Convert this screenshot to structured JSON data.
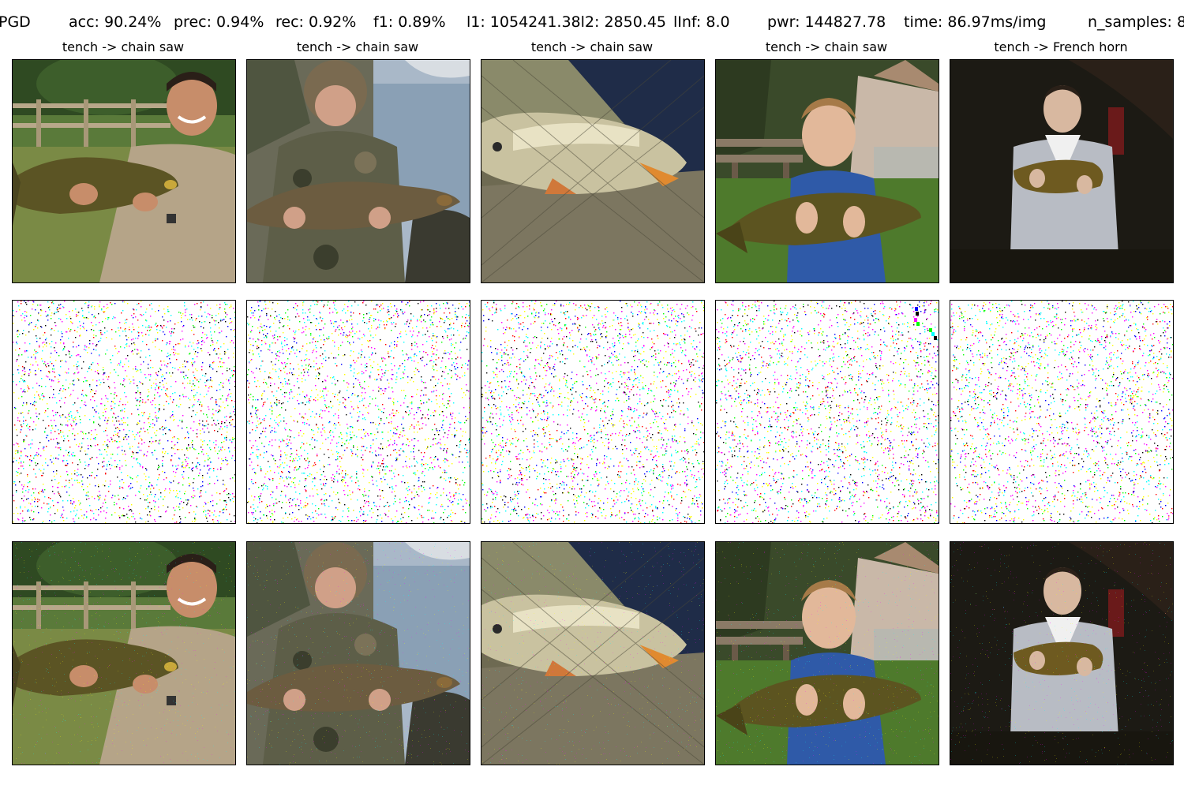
{
  "header": {
    "method": "PGD",
    "acc": "acc: 90.24%",
    "prec": "prec: 0.94%",
    "rec": "rec: 0.92%",
    "f1": "f1: 0.89%",
    "l1l2": "l1: 1054241.38l2: 2850.45",
    "linf": "lInf: 8.0",
    "pwr": "pwr: 144827.78",
    "time": "time: 86.97ms/img",
    "n_samples": "n_samples: 8"
  },
  "columns": [
    {
      "title": "tench -> chain saw",
      "scene": "man with fish by fence"
    },
    {
      "title": "tench -> chain saw",
      "scene": "angler in camo hat by water"
    },
    {
      "title": "tench -> chain saw",
      "scene": "mirror carp in landing net"
    },
    {
      "title": "tench -> chain saw",
      "scene": "boy holding fish in park"
    },
    {
      "title": "tench -> French horn",
      "scene": "man holding fish at night"
    }
  ],
  "rows": [
    "original",
    "perturbation",
    "adversarial"
  ],
  "noise_colors": [
    "#ff00ff",
    "#00ffff",
    "#ffff00",
    "#ff00ff",
    "#00ffff",
    "#ffff00",
    "#0000ff",
    "#00ff00",
    "#ff0000",
    "#000000"
  ]
}
